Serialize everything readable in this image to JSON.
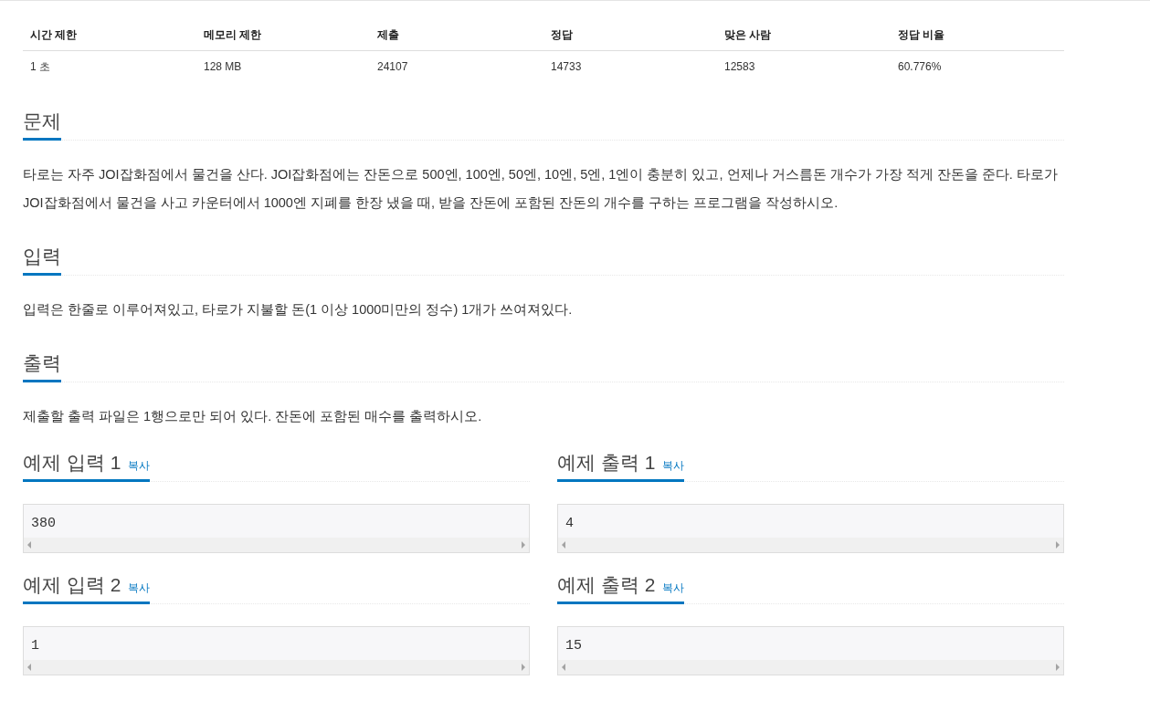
{
  "stats": {
    "columns": [
      "시간 제한",
      "메모리 제한",
      "제출",
      "정답",
      "맞은 사람",
      "정답 비율"
    ],
    "row": [
      "1 초",
      "128 MB",
      "24107",
      "14733",
      "12583",
      "60.776%"
    ]
  },
  "sections": [
    {
      "title": "문제",
      "body": "타로는 자주 JOI잡화점에서 물건을 산다. JOI잡화점에는 잔돈으로 500엔, 100엔, 50엔, 10엔, 5엔, 1엔이 충분히 있고, 언제나 거스름돈 개수가 가장 적게 잔돈을 준다. 타로가 JOI잡화점에서 물건을 사고 카운터에서 1000엔 지폐를 한장 냈을 때, 받을 잔돈에 포함된 잔돈의 개수를 구하는 프로그램을 작성하시오."
    },
    {
      "title": "입력",
      "body": "입력은 한줄로 이루어져있고, 타로가 지불할 돈(1 이상 1000미만의 정수) 1개가 쓰여져있다."
    },
    {
      "title": "출력",
      "body": "제출할 출력 파일은 1행으로만 되어 있다. 잔돈에 포함된 매수를 출력하시오."
    }
  ],
  "samples": [
    {
      "title": "예제 입력 1",
      "copy": "복사",
      "content": "380"
    },
    {
      "title": "예제 출력 1",
      "copy": "복사",
      "content": "4"
    },
    {
      "title": "예제 입력 2",
      "copy": "복사",
      "content": "1"
    },
    {
      "title": "예제 출력 2",
      "copy": "복사",
      "content": "15"
    }
  ]
}
